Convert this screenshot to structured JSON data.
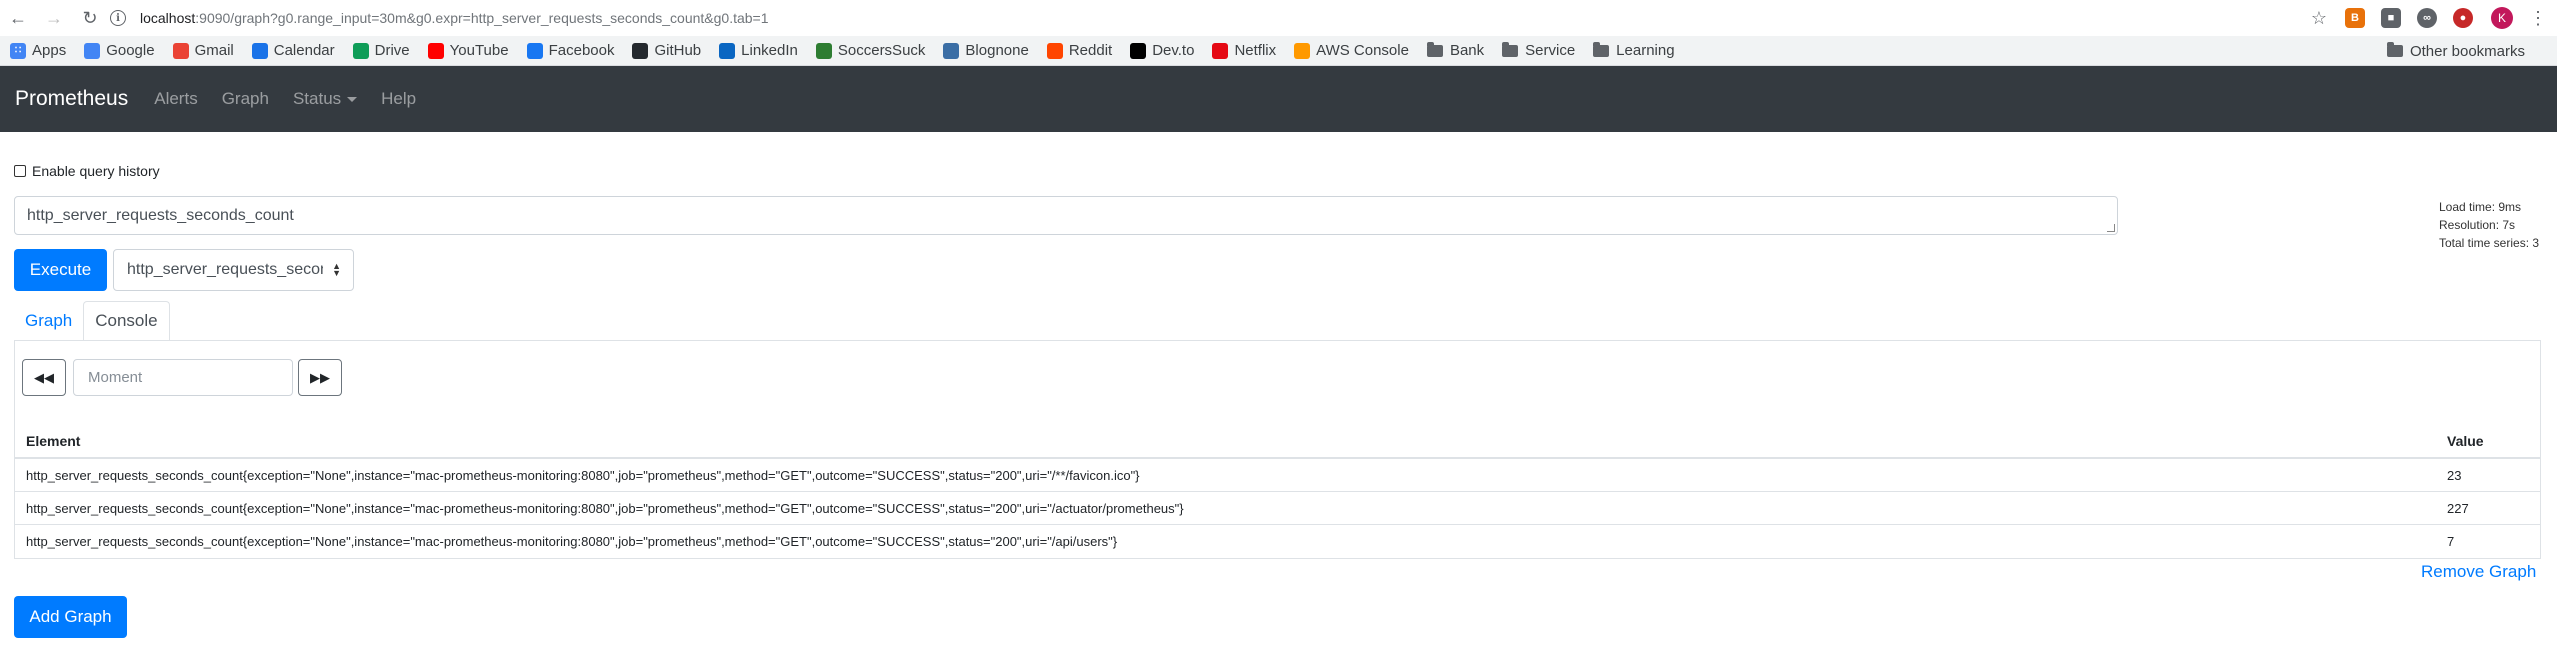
{
  "browser": {
    "url_host": "localhost",
    "url_rest": ":9090/graph?g0.range_input=30m&g0.expr=http_server_requests_seconds_count&g0.tab=1",
    "avatar_letter": "K",
    "bookmarks": [
      {
        "label": "Apps",
        "icon": "apps-grid-icon",
        "color": "#4285f4"
      },
      {
        "label": "Google",
        "icon": "google-icon",
        "color": "#4285f4"
      },
      {
        "label": "Gmail",
        "icon": "gmail-icon",
        "color": "#ea4335"
      },
      {
        "label": "Calendar",
        "icon": "calendar-icon",
        "color": "#1a73e8"
      },
      {
        "label": "Drive",
        "icon": "drive-icon",
        "color": "#0f9d58"
      },
      {
        "label": "YouTube",
        "icon": "youtube-icon",
        "color": "#ff0000"
      },
      {
        "label": "Facebook",
        "icon": "facebook-icon",
        "color": "#1877f2"
      },
      {
        "label": "GitHub",
        "icon": "github-icon",
        "color": "#24292e"
      },
      {
        "label": "LinkedIn",
        "icon": "linkedin-icon",
        "color": "#0a66c2"
      },
      {
        "label": "SoccersSuck",
        "icon": "soccer-icon",
        "color": "#2e7d32"
      },
      {
        "label": "Blognone",
        "icon": "blognone-icon",
        "color": "#3b6ea5"
      },
      {
        "label": "Reddit",
        "icon": "reddit-icon",
        "color": "#ff4500"
      },
      {
        "label": "Dev.to",
        "icon": "devto-icon",
        "color": "#000000"
      },
      {
        "label": "Netflix",
        "icon": "netflix-icon",
        "color": "#e50914"
      },
      {
        "label": "AWS Console",
        "icon": "aws-icon",
        "color": "#ff9900"
      },
      {
        "label": "Bank",
        "icon": "folder-icon",
        "color": "#5f6368"
      },
      {
        "label": "Service",
        "icon": "folder-icon",
        "color": "#5f6368"
      },
      {
        "label": "Learning",
        "icon": "folder-icon",
        "color": "#5f6368"
      }
    ],
    "other_bookmarks": "Other bookmarks"
  },
  "navbar": {
    "brand": "Prometheus",
    "links": [
      "Alerts",
      "Graph",
      "Status",
      "Help"
    ]
  },
  "query": {
    "history_label": "Enable query history",
    "expression": "http_server_requests_seconds_count",
    "execute_label": "Execute",
    "metric_selected": "http_server_requests_seconds_count",
    "stats": {
      "load_time": "Load time: 9ms",
      "resolution": "Resolution: 7s",
      "total_series": "Total time series: 3"
    }
  },
  "tabs": {
    "graph": "Graph",
    "console": "Console",
    "active": "Console"
  },
  "console": {
    "moment_placeholder": "Moment",
    "columns": {
      "element": "Element",
      "value": "Value"
    },
    "rows": [
      {
        "element": "http_server_requests_seconds_count{exception=\"None\",instance=\"mac-prometheus-monitoring:8080\",job=\"prometheus\",method=\"GET\",outcome=\"SUCCESS\",status=\"200\",uri=\"/**/favicon.ico\"}",
        "value": "23"
      },
      {
        "element": "http_server_requests_seconds_count{exception=\"None\",instance=\"mac-prometheus-monitoring:8080\",job=\"prometheus\",method=\"GET\",outcome=\"SUCCESS\",status=\"200\",uri=\"/actuator/prometheus\"}",
        "value": "227"
      },
      {
        "element": "http_server_requests_seconds_count{exception=\"None\",instance=\"mac-prometheus-monitoring:8080\",job=\"prometheus\",method=\"GET\",outcome=\"SUCCESS\",status=\"200\",uri=\"/api/users\"}",
        "value": "7"
      }
    ]
  },
  "actions": {
    "remove_graph": "Remove Graph",
    "add_graph": "Add Graph"
  },
  "colors": {
    "primary": "#007bff",
    "navbar_bg": "#343a40"
  }
}
